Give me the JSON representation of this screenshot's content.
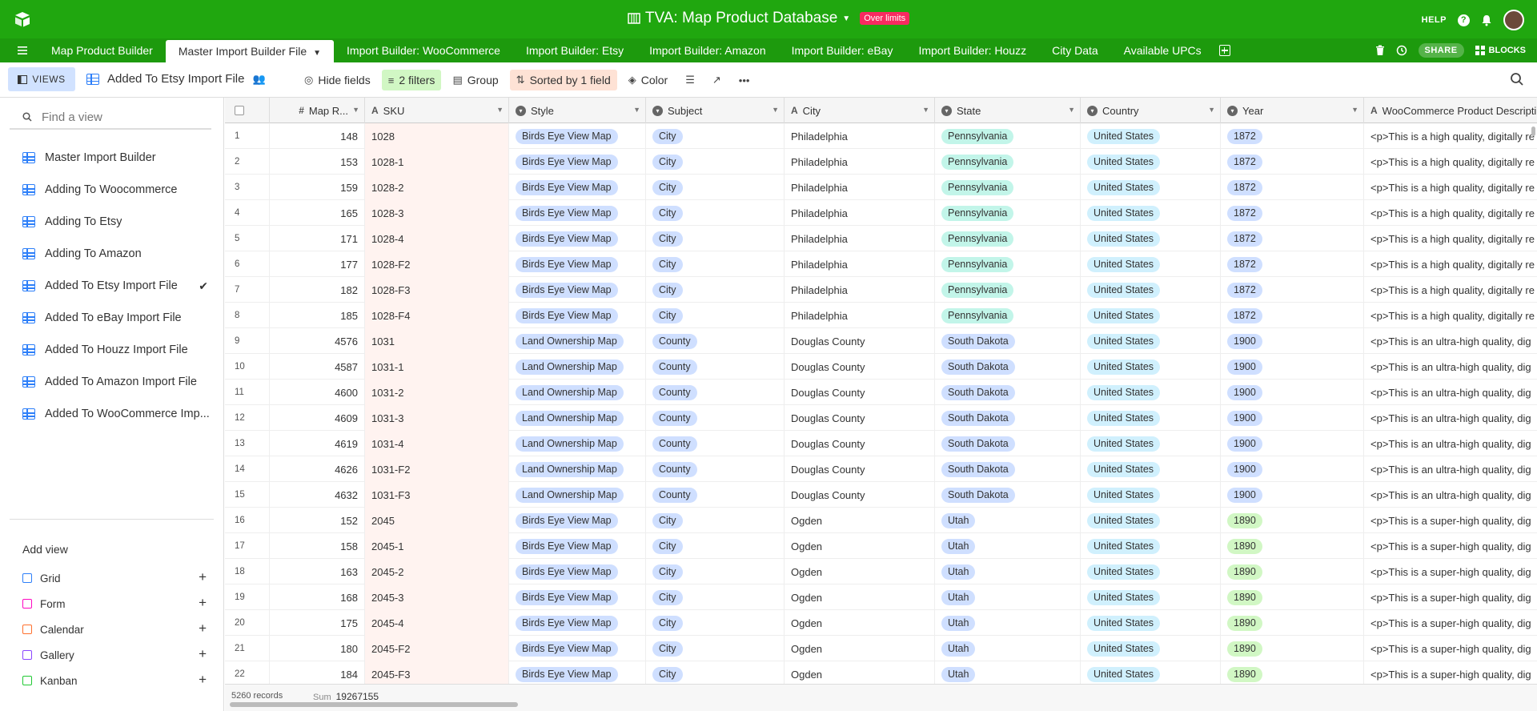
{
  "app": {
    "title": "TVA: Map Product Database",
    "over_limits": "Over limits",
    "help": "HELP",
    "share": "SHARE",
    "blocks": "BLOCKS"
  },
  "tabs": [
    "Map Product Builder",
    "Master Import Builder File",
    "Import Builder: WooCommerce",
    "Import Builder: Etsy",
    "Import Builder: Amazon",
    "Import Builder: eBay",
    "Import Builder: Houzz",
    "City Data",
    "Available UPCs"
  ],
  "toolbar": {
    "views": "VIEWS",
    "view_name": "Added To Etsy Import File",
    "hide_fields": "Hide fields",
    "filters": "2 filters",
    "group": "Group",
    "sorted": "Sorted by 1 field",
    "color": "Color"
  },
  "sidebar": {
    "find_placeholder": "Find a view",
    "views": [
      "Master Import Builder",
      "Adding To Woocommerce",
      "Adding To Etsy",
      "Adding To Amazon",
      "Added To Etsy Import File",
      "Added To eBay Import File",
      "Added To Houzz Import File",
      "Added To Amazon Import File",
      "Added To WooCommerce Imp..."
    ],
    "active_view_index": 4,
    "add_view": "Add view",
    "add_types": [
      {
        "label": "Grid",
        "color": "#2d7ff9"
      },
      {
        "label": "Form",
        "color": "#ff08c2"
      },
      {
        "label": "Calendar",
        "color": "#ff6f2c"
      },
      {
        "label": "Gallery",
        "color": "#8b46ff"
      },
      {
        "label": "Kanban",
        "color": "#20c933"
      }
    ]
  },
  "columns": [
    "Map R...",
    "SKU",
    "Style",
    "Subject",
    "City",
    "State",
    "Country",
    "Year",
    "WooCommerce Product Descripti"
  ],
  "rows": [
    {
      "n": "1",
      "map": "148",
      "sku": "1028",
      "style": "Birds Eye View Map",
      "subject": "City",
      "city": "Philadelphia",
      "state": "Pennsylvania",
      "country": "United States",
      "year": "1872",
      "desc": "<p>This is a high quality, digitally re"
    },
    {
      "n": "2",
      "map": "153",
      "sku": "1028-1",
      "style": "Birds Eye View Map",
      "subject": "City",
      "city": "Philadelphia",
      "state": "Pennsylvania",
      "country": "United States",
      "year": "1872",
      "desc": "<p>This is a high quality, digitally re"
    },
    {
      "n": "3",
      "map": "159",
      "sku": "1028-2",
      "style": "Birds Eye View Map",
      "subject": "City",
      "city": "Philadelphia",
      "state": "Pennsylvania",
      "country": "United States",
      "year": "1872",
      "desc": "<p>This is a high quality, digitally re"
    },
    {
      "n": "4",
      "map": "165",
      "sku": "1028-3",
      "style": "Birds Eye View Map",
      "subject": "City",
      "city": "Philadelphia",
      "state": "Pennsylvania",
      "country": "United States",
      "year": "1872",
      "desc": "<p>This is a high quality, digitally re"
    },
    {
      "n": "5",
      "map": "171",
      "sku": "1028-4",
      "style": "Birds Eye View Map",
      "subject": "City",
      "city": "Philadelphia",
      "state": "Pennsylvania",
      "country": "United States",
      "year": "1872",
      "desc": "<p>This is a high quality, digitally re"
    },
    {
      "n": "6",
      "map": "177",
      "sku": "1028-F2",
      "style": "Birds Eye View Map",
      "subject": "City",
      "city": "Philadelphia",
      "state": "Pennsylvania",
      "country": "United States",
      "year": "1872",
      "desc": "<p>This is a high quality, digitally re"
    },
    {
      "n": "7",
      "map": "182",
      "sku": "1028-F3",
      "style": "Birds Eye View Map",
      "subject": "City",
      "city": "Philadelphia",
      "state": "Pennsylvania",
      "country": "United States",
      "year": "1872",
      "desc": "<p>This is a high quality, digitally re"
    },
    {
      "n": "8",
      "map": "185",
      "sku": "1028-F4",
      "style": "Birds Eye View Map",
      "subject": "City",
      "city": "Philadelphia",
      "state": "Pennsylvania",
      "country": "United States",
      "year": "1872",
      "desc": "<p>This is a high quality, digitally re"
    },
    {
      "n": "9",
      "map": "4576",
      "sku": "1031",
      "style": "Land Ownership Map",
      "subject": "County",
      "city": "Douglas County",
      "state": "South Dakota",
      "country": "United States",
      "year": "1900",
      "desc": "<p>This is an ultra-high quality, dig"
    },
    {
      "n": "10",
      "map": "4587",
      "sku": "1031-1",
      "style": "Land Ownership Map",
      "subject": "County",
      "city": "Douglas County",
      "state": "South Dakota",
      "country": "United States",
      "year": "1900",
      "desc": "<p>This is an ultra-high quality, dig"
    },
    {
      "n": "11",
      "map": "4600",
      "sku": "1031-2",
      "style": "Land Ownership Map",
      "subject": "County",
      "city": "Douglas County",
      "state": "South Dakota",
      "country": "United States",
      "year": "1900",
      "desc": "<p>This is an ultra-high quality, dig"
    },
    {
      "n": "12",
      "map": "4609",
      "sku": "1031-3",
      "style": "Land Ownership Map",
      "subject": "County",
      "city": "Douglas County",
      "state": "South Dakota",
      "country": "United States",
      "year": "1900",
      "desc": "<p>This is an ultra-high quality, dig"
    },
    {
      "n": "13",
      "map": "4619",
      "sku": "1031-4",
      "style": "Land Ownership Map",
      "subject": "County",
      "city": "Douglas County",
      "state": "South Dakota",
      "country": "United States",
      "year": "1900",
      "desc": "<p>This is an ultra-high quality, dig"
    },
    {
      "n": "14",
      "map": "4626",
      "sku": "1031-F2",
      "style": "Land Ownership Map",
      "subject": "County",
      "city": "Douglas County",
      "state": "South Dakota",
      "country": "United States",
      "year": "1900",
      "desc": "<p>This is an ultra-high quality, dig"
    },
    {
      "n": "15",
      "map": "4632",
      "sku": "1031-F3",
      "style": "Land Ownership Map",
      "subject": "County",
      "city": "Douglas County",
      "state": "South Dakota",
      "country": "United States",
      "year": "1900",
      "desc": "<p>This is an ultra-high quality, dig"
    },
    {
      "n": "16",
      "map": "152",
      "sku": "2045",
      "style": "Birds Eye View Map",
      "subject": "City",
      "city": "Ogden",
      "state": "Utah",
      "country": "United States",
      "year": "1890",
      "desc": "<p>This is a super-high quality, dig"
    },
    {
      "n": "17",
      "map": "158",
      "sku": "2045-1",
      "style": "Birds Eye View Map",
      "subject": "City",
      "city": "Ogden",
      "state": "Utah",
      "country": "United States",
      "year": "1890",
      "desc": "<p>This is a super-high quality, dig"
    },
    {
      "n": "18",
      "map": "163",
      "sku": "2045-2",
      "style": "Birds Eye View Map",
      "subject": "City",
      "city": "Ogden",
      "state": "Utah",
      "country": "United States",
      "year": "1890",
      "desc": "<p>This is a super-high quality, dig"
    },
    {
      "n": "19",
      "map": "168",
      "sku": "2045-3",
      "style": "Birds Eye View Map",
      "subject": "City",
      "city": "Ogden",
      "state": "Utah",
      "country": "United States",
      "year": "1890",
      "desc": "<p>This is a super-high quality, dig"
    },
    {
      "n": "20",
      "map": "175",
      "sku": "2045-4",
      "style": "Birds Eye View Map",
      "subject": "City",
      "city": "Ogden",
      "state": "Utah",
      "country": "United States",
      "year": "1890",
      "desc": "<p>This is a super-high quality, dig"
    },
    {
      "n": "21",
      "map": "180",
      "sku": "2045-F2",
      "style": "Birds Eye View Map",
      "subject": "City",
      "city": "Ogden",
      "state": "Utah",
      "country": "United States",
      "year": "1890",
      "desc": "<p>This is a super-high quality, dig"
    },
    {
      "n": "22",
      "map": "184",
      "sku": "2045-F3",
      "style": "Birds Eye View Map",
      "subject": "City",
      "city": "Ogden",
      "state": "Utah",
      "country": "United States",
      "year": "1890",
      "desc": "<p>This is a super-high quality, dig"
    }
  ],
  "pill_colors": {
    "Birds Eye View Map": "#cfdfff",
    "Land Ownership Map": "#cfdfff",
    "City": "#cfdfff",
    "County": "#cfdfff",
    "Pennsylvania": "#c2f5e9",
    "South Dakota": "#cfdfff",
    "Utah": "#cfdfff",
    "United States": "#d0f0fd",
    "1872": "#cfdfff",
    "1900": "#cfdfff",
    "1890": "#d1f7c4"
  },
  "footer": {
    "records": "5260 records",
    "sum_label": "Sum",
    "sum_value": "19267155"
  }
}
